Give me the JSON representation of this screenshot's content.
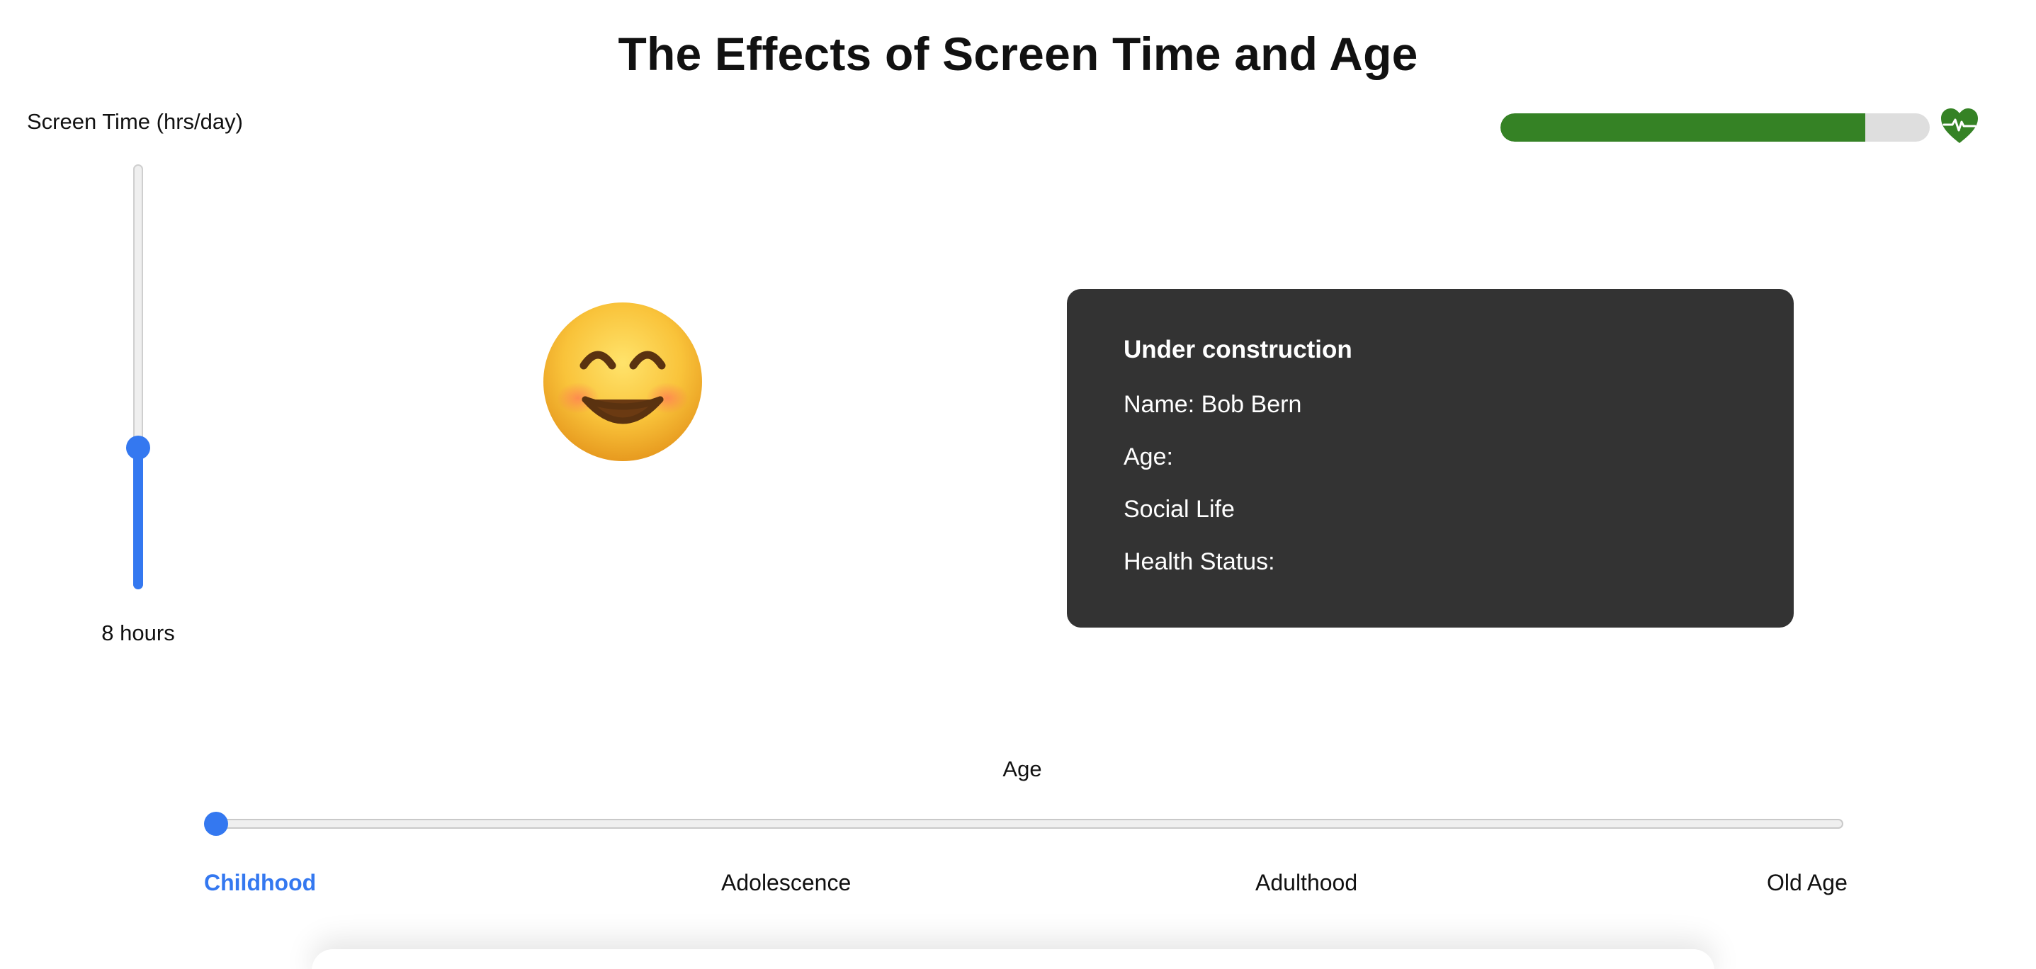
{
  "page": {
    "title": "The Effects of Screen Time and Age"
  },
  "screen_time": {
    "label": "Screen Time (hrs/day)",
    "value": 8,
    "max": 24,
    "readout": "8 hours"
  },
  "health": {
    "level": 0.85,
    "fill_color": "#358225",
    "icon": "heart-pulse-icon"
  },
  "mood": {
    "icon": "smiling-face-icon"
  },
  "info_card": {
    "heading": "Under construction",
    "name_line": "Name: Bob Bern",
    "age_line": "Age:",
    "social_line": "Social Life",
    "health_line": "Health Status:"
  },
  "age": {
    "label": "Age",
    "value_index": 0,
    "stages": [
      "Childhood",
      "Adolescence",
      "Adulthood",
      "Old Age"
    ],
    "selected": "Childhood"
  },
  "colors": {
    "accent": "#3478f0",
    "card_bg": "#333333"
  }
}
